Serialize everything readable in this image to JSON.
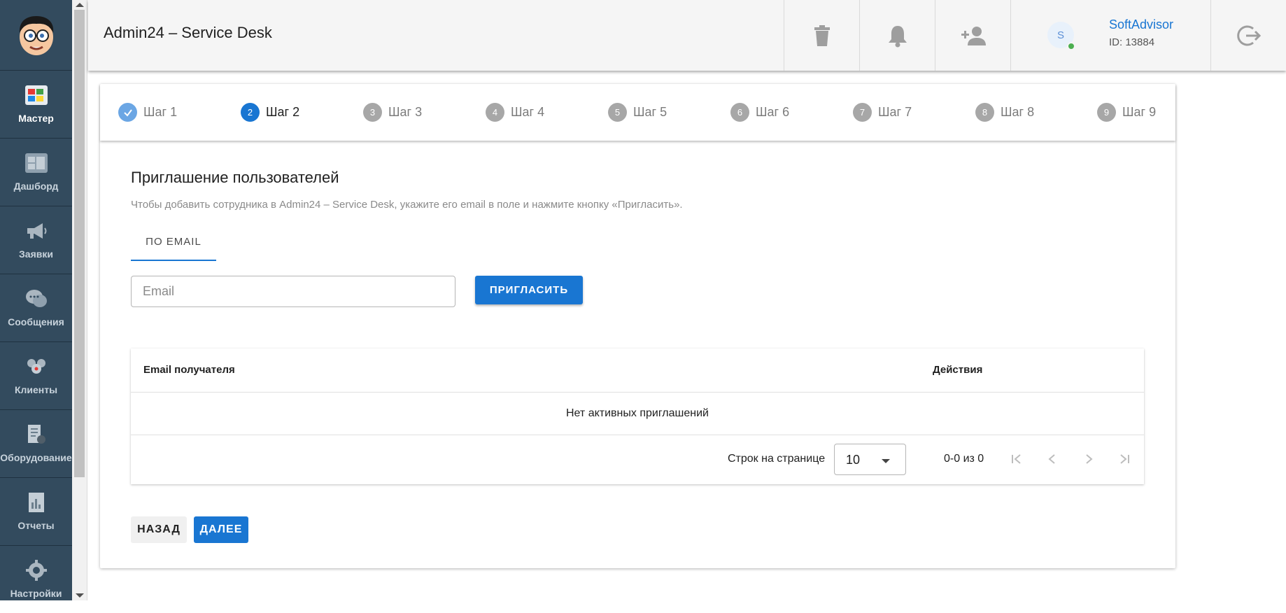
{
  "sidebar": {
    "logo_icon": "cartoon-face-logo",
    "items": [
      {
        "label": "Мастер",
        "icon": "wizard-icon",
        "active": true
      },
      {
        "label": "Дашборд",
        "icon": "dashboard-icon",
        "active": false
      },
      {
        "label": "Заявки",
        "icon": "megaphone-icon",
        "active": false
      },
      {
        "label": "Сообщения",
        "icon": "chat-icon",
        "active": false
      },
      {
        "label": "Клиенты",
        "icon": "clients-icon",
        "active": false
      },
      {
        "label": "Оборудование",
        "icon": "equipment-icon",
        "active": false
      },
      {
        "label": "Отчеты",
        "icon": "reports-icon",
        "active": false
      },
      {
        "label": "Настройки",
        "icon": "gear-icon",
        "active": false
      }
    ]
  },
  "header": {
    "title": "Admin24 – Service Desk",
    "actions": [
      "trash-icon",
      "bell-icon",
      "add-user-icon",
      "logout-icon"
    ],
    "user": {
      "avatar_letter": "S",
      "name": "SoftAdvisor",
      "id_label": "ID: 13884"
    }
  },
  "stepper": {
    "steps": [
      {
        "num": "1",
        "label": "Шаг 1",
        "state": "done"
      },
      {
        "num": "2",
        "label": "Шаг 2",
        "state": "active"
      },
      {
        "num": "3",
        "label": "Шаг 3",
        "state": "todo"
      },
      {
        "num": "4",
        "label": "Шаг 4",
        "state": "todo"
      },
      {
        "num": "5",
        "label": "Шаг 5",
        "state": "todo"
      },
      {
        "num": "6",
        "label": "Шаг 6",
        "state": "todo"
      },
      {
        "num": "7",
        "label": "Шаг 7",
        "state": "todo"
      },
      {
        "num": "8",
        "label": "Шаг 8",
        "state": "todo"
      },
      {
        "num": "9",
        "label": "Шаг 9",
        "state": "todo"
      }
    ]
  },
  "invite": {
    "title": "Приглашение пользователей",
    "description": "Чтобы добавить сотрудника в Admin24 – Service Desk, укажите его email в поле и нажмите кнопку «Пригласить».",
    "tab_label": "ПО EMAIL",
    "email_placeholder": "Email",
    "email_value": "",
    "invite_button": "ПРИГЛАСИТЬ"
  },
  "table": {
    "columns": [
      "Email получателя",
      "Действия"
    ],
    "empty_text": "Нет активных приглашений",
    "rows_per_page_label": "Строк на странице",
    "rows_per_page_value": "10",
    "range_text": "0-0 из 0"
  },
  "footer": {
    "back_label": "НАЗАД",
    "next_label": "ДАЛЕЕ"
  },
  "colors": {
    "accent": "#1976d2",
    "sidebar_bg": "#334b5e",
    "online": "#4caf50"
  }
}
